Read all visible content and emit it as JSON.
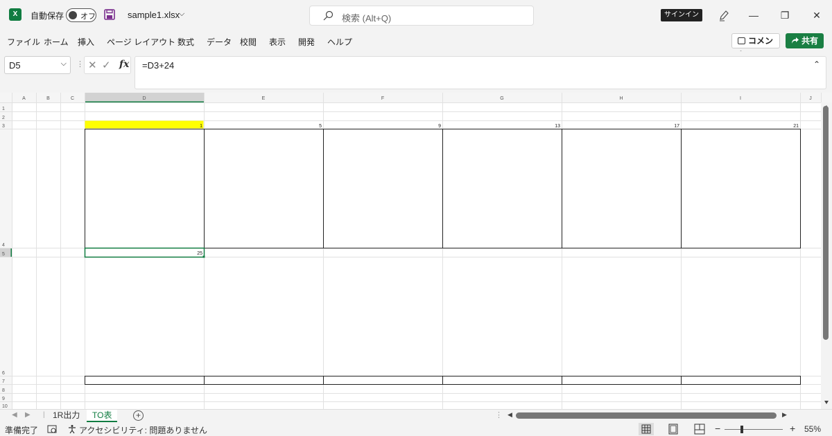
{
  "titlebar": {
    "app_icon_letter": "X",
    "autosave_label": "自動保存",
    "autosave_state": "オフ",
    "filename": "sample1.xlsx",
    "search_placeholder": "検索 (Alt+Q)",
    "signin_label": "サインイン",
    "window_buttons": {
      "minimize": "—",
      "restore": "❐",
      "close": "✕"
    }
  },
  "menu": {
    "items": [
      "ファイル",
      "ホーム",
      "挿入",
      "ページ レイアウト",
      "数式",
      "データ",
      "校閲",
      "表示",
      "開発",
      "ヘルプ"
    ],
    "comment_label": "コメント",
    "share_label": "共有"
  },
  "formula_bar": {
    "name_box": "D5",
    "cancel_glyph": "✕",
    "enter_glyph": "✓",
    "fx_label": "fx",
    "formula": "=D3+24"
  },
  "grid": {
    "columns": [
      "A",
      "B",
      "C",
      "D",
      "E",
      "F",
      "G",
      "H",
      "I",
      "J"
    ],
    "selected_column": "D",
    "rows": [
      "1",
      "2",
      "3",
      "4",
      "5",
      "6",
      "7",
      "8",
      "9",
      "10"
    ],
    "selected_row": "5",
    "row3_values": {
      "D": "1",
      "E": "5",
      "F": "9",
      "G": "13",
      "H": "17",
      "I": "21"
    },
    "row5_values": {
      "D": "25"
    },
    "highlight_color": "#ffff00",
    "selection_color": "#107c41"
  },
  "sheet_tabs": {
    "tabs": [
      "1R出力",
      "TO表"
    ],
    "active": "TO表",
    "add_label": "+"
  },
  "status_bar": {
    "ready": "準備完了",
    "accessibility": "アクセシビリティ: 問題ありません",
    "zoom_minus": "−",
    "zoom_plus": "+",
    "zoom_level": "55%",
    "zoom_fraction": 0.3
  },
  "icons": {
    "app": "excel-icon",
    "save": "save-icon",
    "search": "search-icon",
    "pen": "pen-icon",
    "comment": "comment-icon",
    "macro": "macro-icon",
    "accessibility": "accessibility-icon"
  }
}
